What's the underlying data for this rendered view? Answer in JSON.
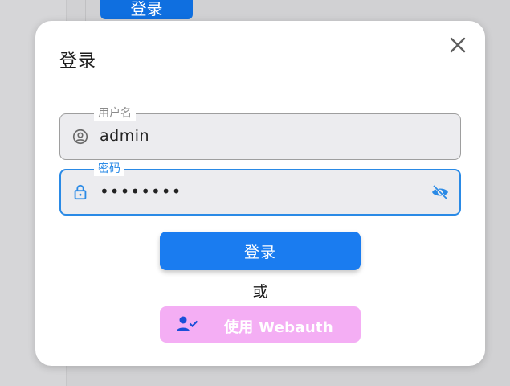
{
  "background": {
    "button_label": "登录"
  },
  "dialog": {
    "title": "登录",
    "close_icon": "close-icon",
    "username": {
      "label": "用户名",
      "value": "admin",
      "icon": "user-circle-icon"
    },
    "password": {
      "label": "密码",
      "value": "••••••••",
      "icon": "lock-icon",
      "toggle_icon": "eye-off-icon"
    },
    "login_button": "登录",
    "or_text": "或",
    "webauthn_button": "使用 Webauth",
    "webauthn_icon": "user-check-icon"
  },
  "colors": {
    "primary": "#1a7cf0",
    "focus_border": "#2a8ae6",
    "webauthn_bg": "#f4aef4",
    "webauthn_icon": "#1a4fd8",
    "field_bg": "#ececef"
  }
}
